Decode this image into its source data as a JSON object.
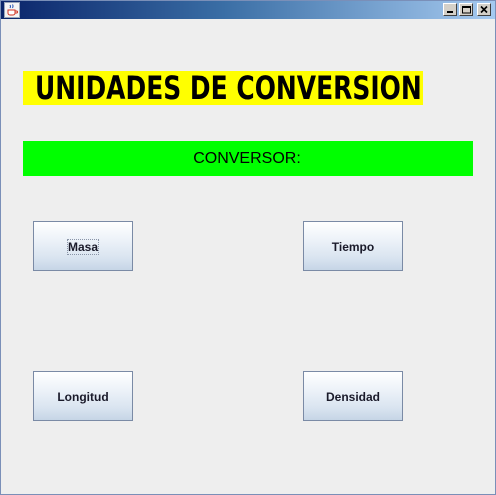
{
  "window": {
    "icon": "java-cup-icon",
    "controls": [
      "minimize-icon",
      "maximize-icon",
      "close-icon"
    ]
  },
  "main": {
    "heading": "UNIDADES DE CONVERSION",
    "banner": "CONVERSOR:",
    "buttons": {
      "masa": "Masa",
      "tiempo": "Tiempo",
      "longitud": "Longitud",
      "densidad": "Densidad"
    }
  },
  "colors": {
    "heading_bg": "#ffff00",
    "banner_bg": "#00ff00",
    "window_bg": "#eeeeee",
    "titlebar_start": "#0a246a",
    "titlebar_end": "#a6caf0"
  }
}
